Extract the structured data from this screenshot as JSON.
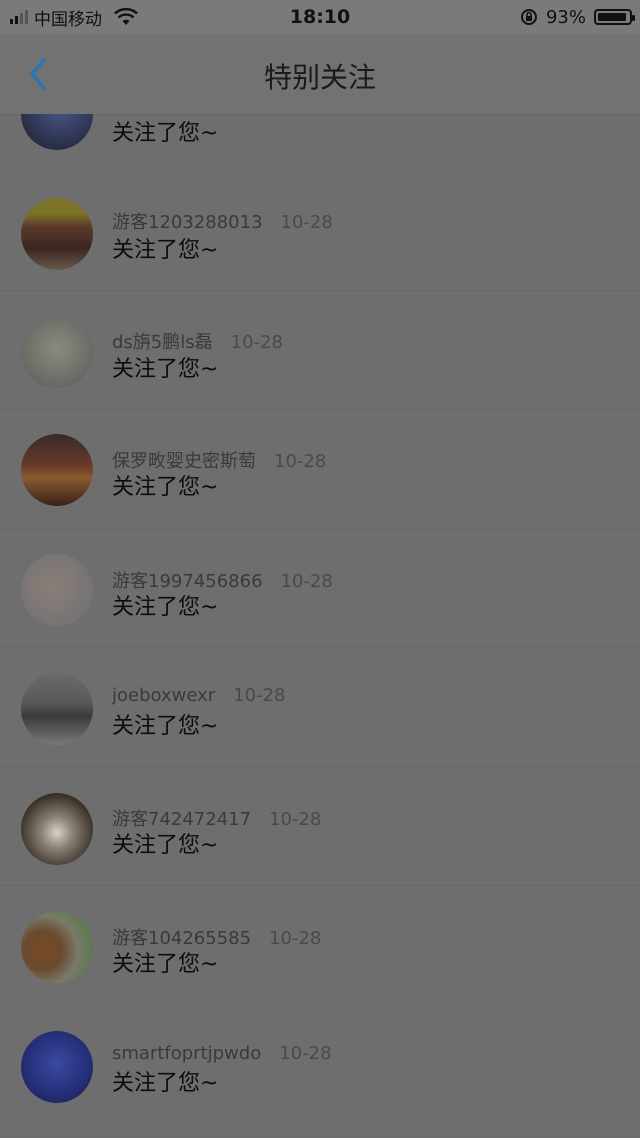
{
  "status_bar": {
    "carrier": "中国移动",
    "time": "18:10",
    "battery_percent": "93%",
    "battery_level": 0.93,
    "icons": [
      "signal-icon",
      "wifi-icon",
      "rotation-lock-icon",
      "battery-icon"
    ]
  },
  "nav": {
    "title": "特别关注",
    "back_icon": "chevron-left-icon",
    "accent_color": "#2b74b8"
  },
  "rows": [
    {
      "name": "",
      "date": "",
      "message": "关注了您~"
    },
    {
      "name": "游客1203288013",
      "date": "10-28",
      "message": "关注了您~"
    },
    {
      "name": "ds旃5鹏ls磊",
      "date": "10-28",
      "message": "关注了您~"
    },
    {
      "name": "保罗畋婴史密斯萄",
      "date": "10-28",
      "message": "关注了您~"
    },
    {
      "name": "游客1997456866",
      "date": "10-28",
      "message": "关注了您~"
    },
    {
      "name": "joeboxwexr",
      "date": "10-28",
      "message": "关注了您~"
    },
    {
      "name": "游客742472417",
      "date": "10-28",
      "message": "关注了您~"
    },
    {
      "name": "游客104265585",
      "date": "10-28",
      "message": "关注了您~"
    },
    {
      "name": "smartfoprtjpwdo",
      "date": "10-28",
      "message": "关注了您~"
    }
  ]
}
